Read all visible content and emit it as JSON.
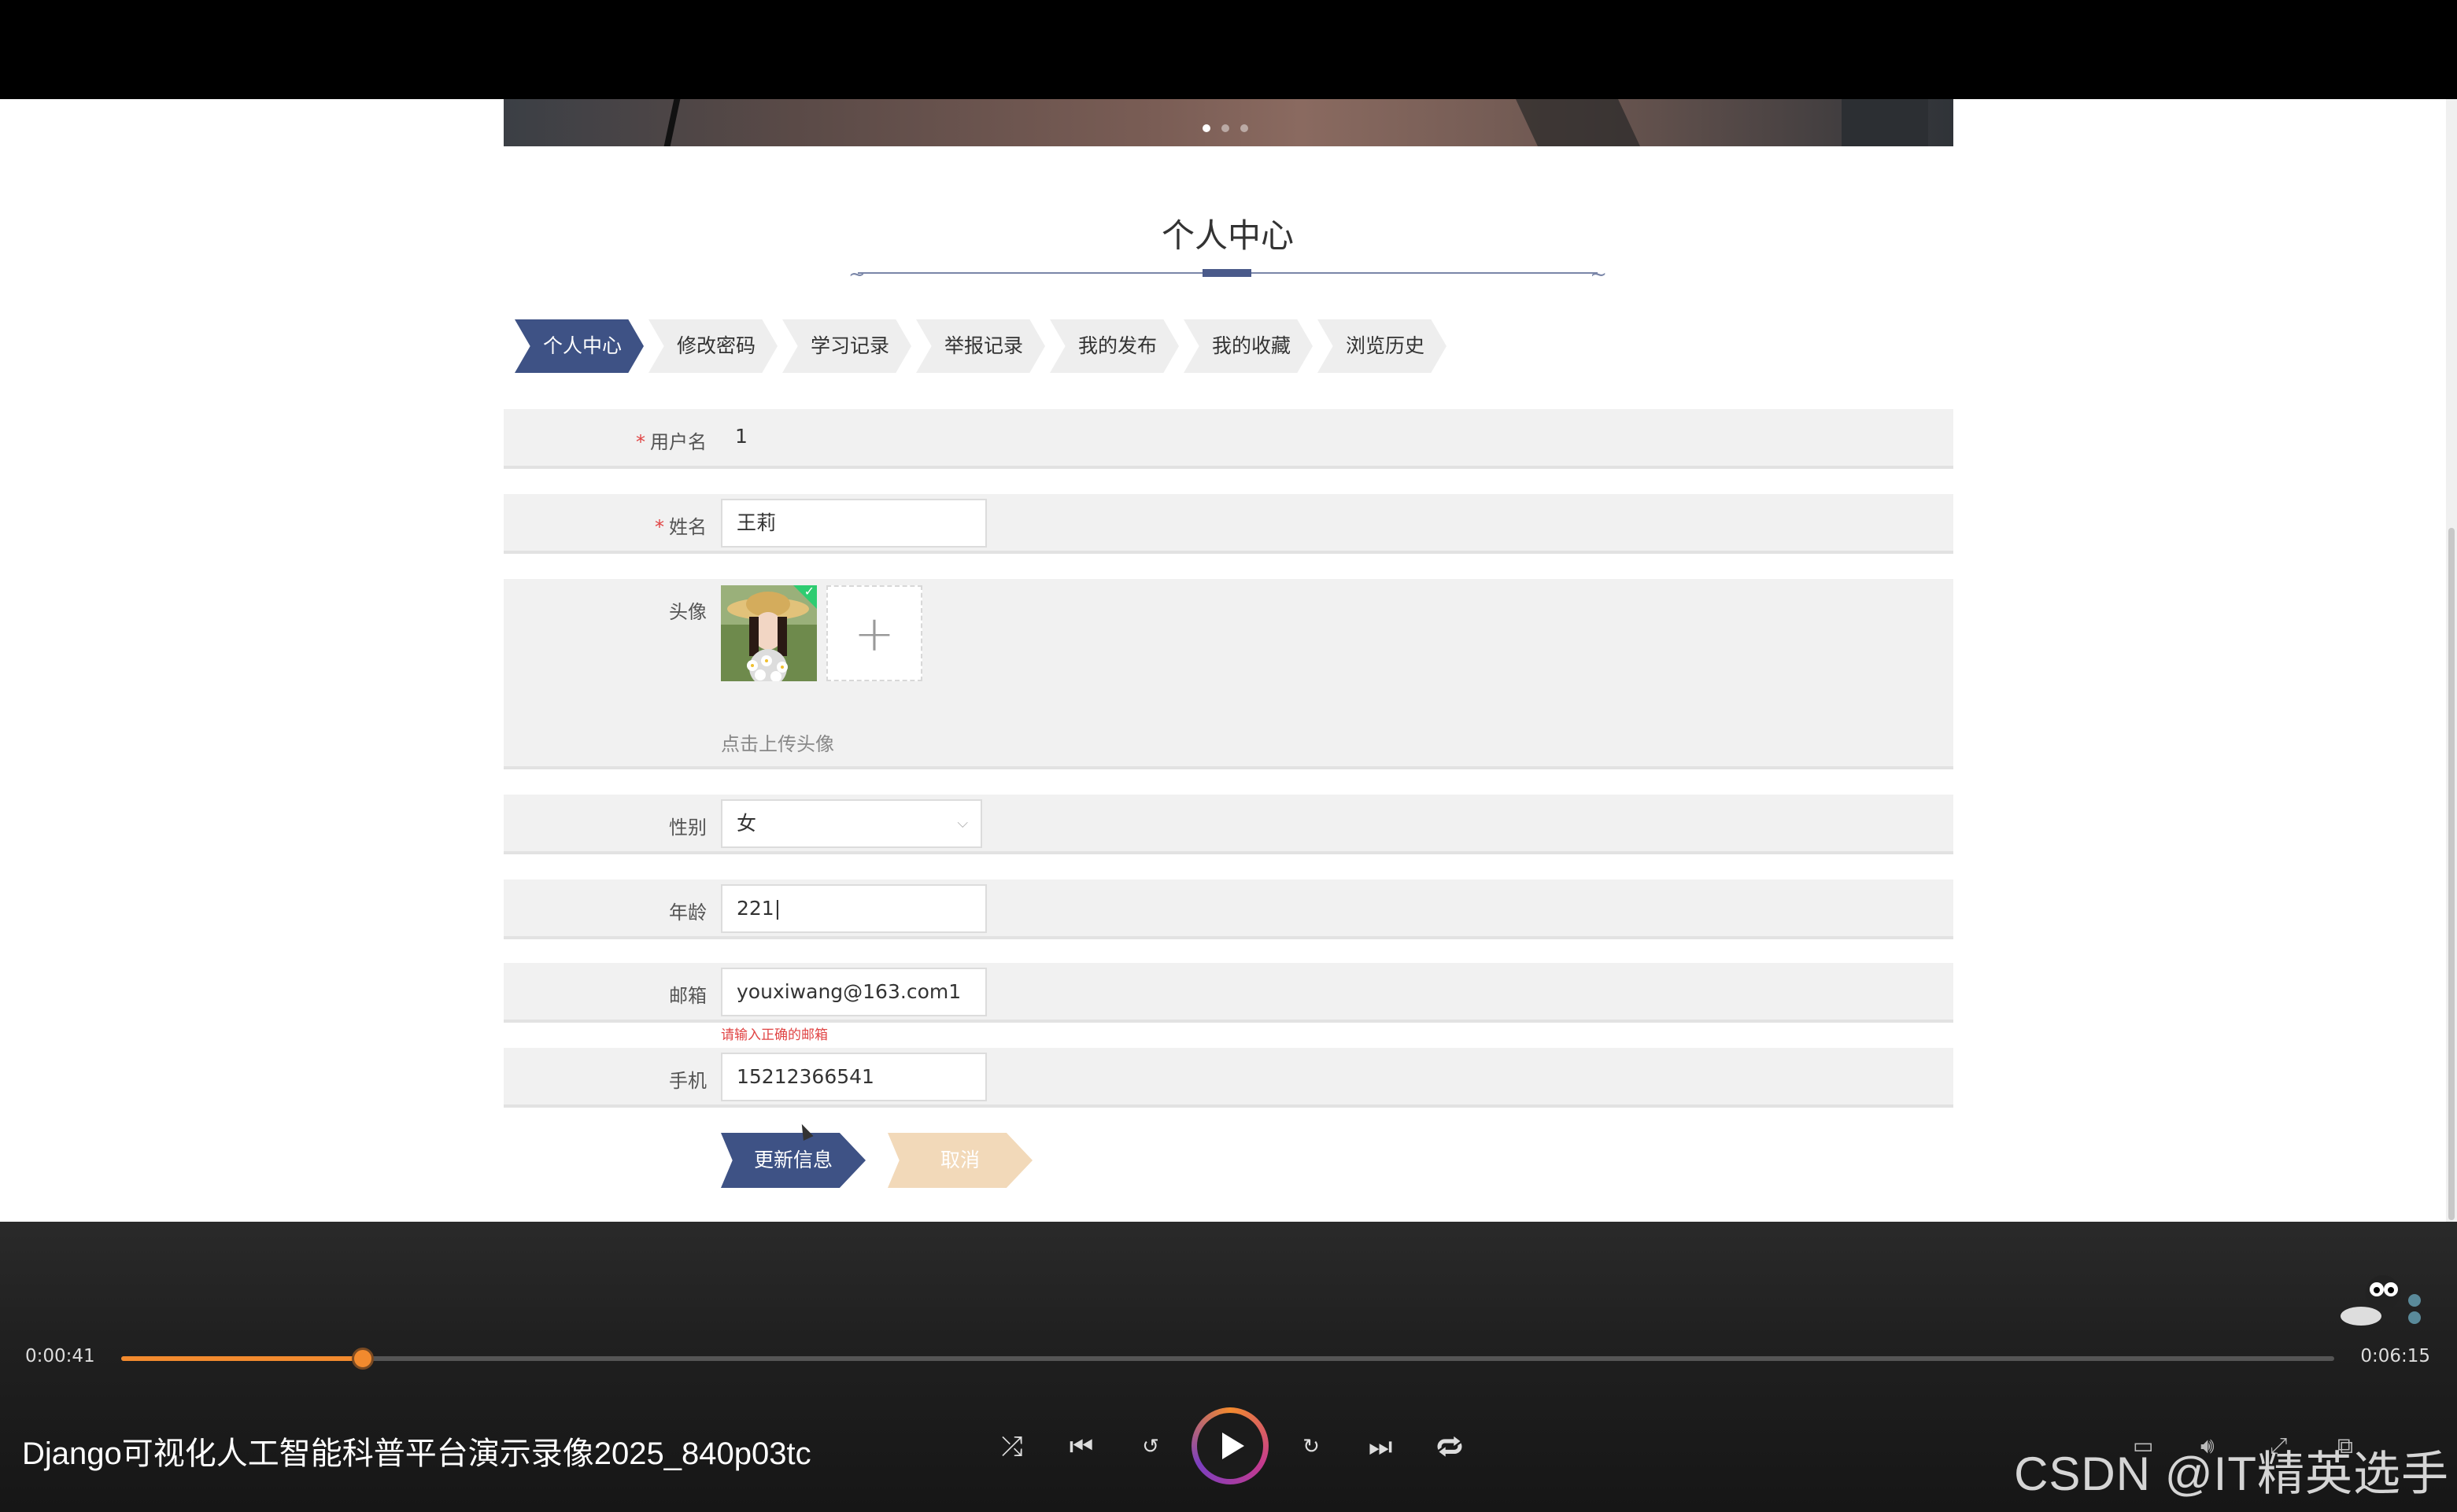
{
  "page": {
    "title": "个人中心",
    "tabs": [
      "个人中心",
      "修改密码",
      "学习记录",
      "举报记录",
      "我的发布",
      "我的收藏",
      "浏览历史"
    ],
    "active_tab": 0
  },
  "form": {
    "username": {
      "label": "用户名",
      "value": "1",
      "required": true
    },
    "name": {
      "label": "姓名",
      "value": "王莉",
      "required": true
    },
    "avatar": {
      "label": "头像",
      "upload_hint": "点击上传头像",
      "plus": "+"
    },
    "gender": {
      "label": "性别",
      "value": "女"
    },
    "age": {
      "label": "年龄",
      "value": "221"
    },
    "email": {
      "label": "邮箱",
      "value": "youxiwang@163.com1",
      "error": "请输入正确的邮箱"
    },
    "phone": {
      "label": "手机",
      "value": "15212366541"
    },
    "required_mark": "*",
    "submit_label": "更新信息",
    "cancel_label": "取消"
  },
  "player": {
    "current_time": "0:00:41",
    "total_time": "0:06:15",
    "progress": 0.109,
    "media_title": "Django可视化人工智能科普平台演示录像2025_840p03tc",
    "watermark": "CSDN @IT精英选手",
    "accent": "#f28a2e"
  },
  "colors": {
    "primary": "#3e5285",
    "cancel": "#f2d9b9",
    "error": "#e04444"
  }
}
